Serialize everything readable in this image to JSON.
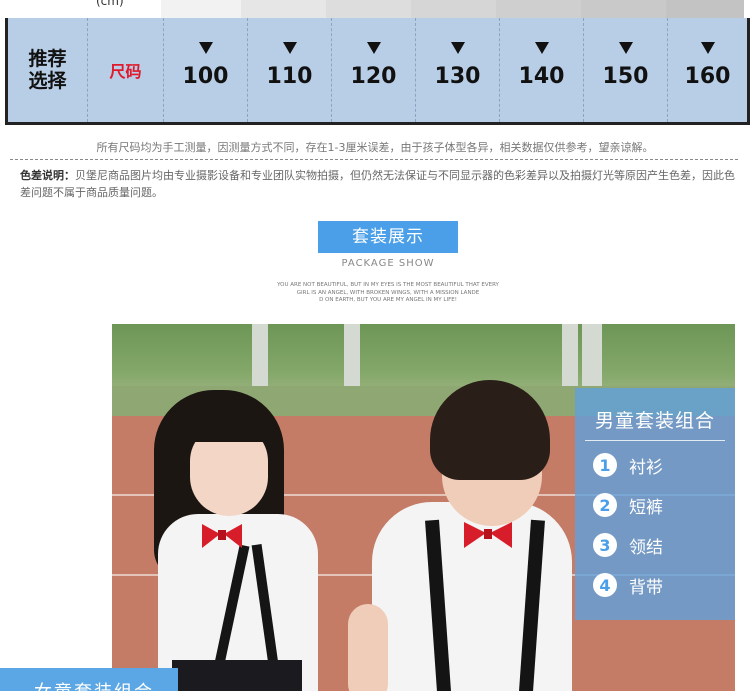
{
  "top_fragment": "(cm)",
  "size_table": {
    "label_lines": [
      "推荐",
      "选择"
    ],
    "unit_label": "尺码",
    "sizes": [
      "100",
      "110",
      "120",
      "130",
      "140",
      "150",
      "160"
    ]
  },
  "notes": {
    "measure_note": "所有尺码均为手工测量，因测量方式不同，存在1-3厘米误差，由于孩子体型各异，相关数据仅供参考，望亲谅解。",
    "color_note_label": "色差说明：",
    "color_note_text": "贝堡尼商品图片均由专业摄影设备和专业团队实物拍摄，但仍然无法保证与不同显示器的色彩差异以及拍摄灯光等原因产生色差，因此色差问题不属于商品质量问题。"
  },
  "section": {
    "title": "套装展示",
    "subtitle": "PACKAGE SHOW",
    "english_lines": [
      "YOU ARE NOT BEAUTIFUL, BUT IN MY EYES IS THE MOST BEAUTIFUL THAT EVERY",
      "GIRL IS AN ANGEL, WITH BROKEN WINGS, WITH A MISSION LANDE",
      "D ON EARTH, BUT YOU ARE MY ANGEL IN MY LIFE!"
    ]
  },
  "card": {
    "title": "男童套装组合",
    "items": [
      {
        "num": "1",
        "label": "衬衫"
      },
      {
        "num": "2",
        "label": "短裤"
      },
      {
        "num": "3",
        "label": "领结"
      },
      {
        "num": "4",
        "label": "背带"
      }
    ]
  },
  "bottom_banner": "女童套装组合",
  "colors": {
    "accent_blue": "#4a9fe8",
    "table_bg": "#b8cee6",
    "unit_red": "#e0192b",
    "bow_red": "#d81d2a"
  }
}
